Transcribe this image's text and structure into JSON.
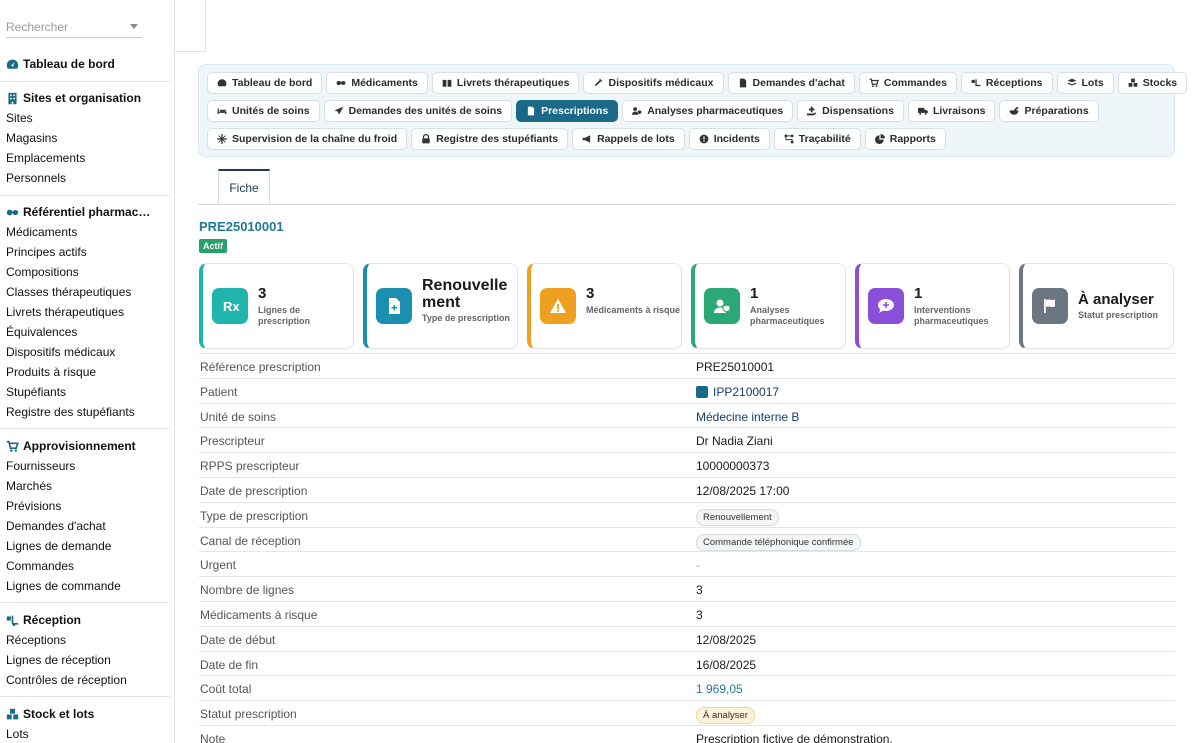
{
  "sidebar": {
    "search_placeholder": "Rechercher",
    "dashboard": "Tableau de bord",
    "sections": [
      {
        "title": "Sites et organisation",
        "items": [
          "Sites",
          "Magasins",
          "Emplacements",
          "Personnels"
        ]
      },
      {
        "title": "Référentiel pharmac…",
        "items": [
          "Médicaments",
          "Principes actifs",
          "Compositions",
          "Classes thérapeutiques",
          "Livrets thérapeutiques",
          "Équivalences",
          "Dispositifs médicaux",
          "Produits à risque",
          "Stupéfiants",
          "Registre des stupéfiants"
        ]
      },
      {
        "title": "Approvisionnement",
        "items": [
          "Fournisseurs",
          "Marchés",
          "Prévisions",
          "Demandes d'achat",
          "Lignes de demande",
          "Commandes",
          "Lignes de commande"
        ]
      },
      {
        "title": "Réception",
        "items": [
          "Réceptions",
          "Lignes de réception",
          "Contrôles de réception"
        ]
      },
      {
        "title": "Stock et lots",
        "items": [
          "Lots"
        ]
      }
    ]
  },
  "nav": {
    "row1": [
      "Tableau de bord",
      "Médicaments",
      "Livrets thérapeutiques",
      "Dispositifs médicaux",
      "Demandes d'achat",
      "Commandes",
      "Réceptions",
      "Lots",
      "Stocks"
    ],
    "row2": [
      "Unités de soins",
      "Demandes des unités de soins",
      "Prescriptions",
      "Analyses pharmaceutiques",
      "Dispensations",
      "Livraisons",
      "Préparations"
    ],
    "row3": [
      "Supervision de la chaîne du froid",
      "Registre des stupéfiants",
      "Rappels de lots",
      "Incidents",
      "Traçabilité",
      "Rapports"
    ],
    "active": "Prescriptions"
  },
  "tabs": {
    "fiche": "Fiche"
  },
  "record": {
    "title": "PRE25010001",
    "status_badge": "Actif"
  },
  "kpis": [
    {
      "value": "3",
      "label": "Lignes de prescription",
      "color": "#1fb5ad",
      "icon": "rx-icon"
    },
    {
      "value": "Renouvellement",
      "label": "Type de prescription",
      "color": "#1a8fb0",
      "icon": "file-plus-icon"
    },
    {
      "value": "3",
      "label": "Médicaments à risque",
      "color": "#f0a020",
      "icon": "warning-icon"
    },
    {
      "value": "1",
      "label": "Analyses pharmaceutiques",
      "color": "#2aa876",
      "icon": "user-shield-icon"
    },
    {
      "value": "1",
      "label": "Interventions pharmaceutiques",
      "color": "#8a4fd8",
      "icon": "comment-plus-icon"
    },
    {
      "value": "À analyser",
      "label": "Statut prescription",
      "color": "#6c7683",
      "icon": "flag-icon"
    }
  ],
  "details": [
    {
      "label": "Référence prescription",
      "value": "PRE25010001"
    },
    {
      "label": "Patient",
      "value": "IPP2100017"
    },
    {
      "label": "Unité de soins",
      "value": "Médecine interne B"
    },
    {
      "label": "Prescripteur",
      "value": "Dr Nadia Ziani"
    },
    {
      "label": "RPPS prescripteur",
      "value": "10000000373"
    },
    {
      "label": "Date de prescription",
      "value": "12/08/2025 17:00"
    },
    {
      "label": "Type de prescription",
      "value": "Renouvellement"
    },
    {
      "label": "Canal de réception",
      "value": "Commande téléphonique confirmée"
    },
    {
      "label": "Urgent",
      "value": "-"
    },
    {
      "label": "Nombre de lignes",
      "value": "3"
    },
    {
      "label": "Médicaments à risque",
      "value": "3"
    },
    {
      "label": "Date de début",
      "value": "12/08/2025"
    },
    {
      "label": "Date de fin",
      "value": "16/08/2025"
    },
    {
      "label": "Coût total",
      "value": "1 969,05"
    },
    {
      "label": "Statut prescription",
      "value": "À analyser"
    },
    {
      "label": "Note",
      "value": "Prescription fictive de démonstration."
    }
  ]
}
